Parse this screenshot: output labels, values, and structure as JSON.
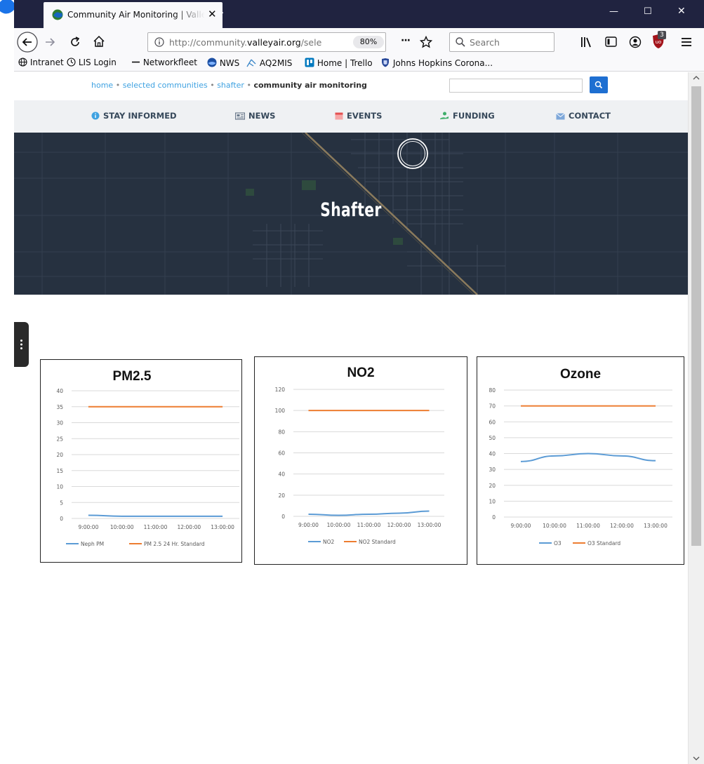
{
  "browser": {
    "tab_title": "Community Air Monitoring | Valley Air",
    "new_tab_symbol": "+",
    "close_tab_symbol": "✕",
    "url_prefix": "http://community.",
    "url_domain": "valleyair.org",
    "url_path": "/sele",
    "zoom_level": "80%",
    "page_actions": "···",
    "search_placeholder": "Search",
    "addon_badge": "3",
    "window_minimize": "—",
    "window_maximize": "☐",
    "window_close": "✕"
  },
  "bookmarks": [
    {
      "label": "Intranet",
      "icon": "globe-icon"
    },
    {
      "label": "LIS Login",
      "icon": "clock-icon"
    },
    {
      "label": "Networkfleet",
      "icon": "line-icon"
    },
    {
      "label": "NWS",
      "icon": "nws-logo-icon"
    },
    {
      "label": "AQ2MIS",
      "icon": "antenna-icon"
    },
    {
      "label": "Home | Trello",
      "icon": "trello-icon"
    },
    {
      "label": "Johns Hopkins Corona...",
      "icon": "shield-icon"
    }
  ],
  "breadcrumb": {
    "items": [
      "home",
      "selected communities",
      "shafter"
    ],
    "separator": "•",
    "current": "community air monitoring"
  },
  "nav": {
    "stay_informed": "STAY INFORMED",
    "news": "NEWS",
    "events": "EVENTS",
    "funding": "FUNDING",
    "contact": "CONTACT"
  },
  "hero": {
    "title": "Shafter"
  },
  "colors": {
    "series_blue": "#5b9bd5",
    "series_orange": "#ed7d31",
    "accent_button": "#1e6fd1",
    "hero_bg": "#263140"
  },
  "chart_data": [
    {
      "type": "line",
      "title": "PM2.5",
      "categories": [
        "9:00:00",
        "10:00:00",
        "11:00:00",
        "12:00:00",
        "13:00:00"
      ],
      "ylim": [
        0,
        40
      ],
      "yticks": [
        0,
        5,
        10,
        15,
        20,
        25,
        30,
        35,
        40
      ],
      "legend": "bottom",
      "grid": true,
      "series": [
        {
          "name": "Neph PM",
          "color": "#5b9bd5",
          "values": [
            1,
            0.7,
            0.7,
            0.7,
            0.7
          ]
        },
        {
          "name": "PM 2.5 24 Hr. Standard",
          "color": "#ed7d31",
          "values": [
            35,
            35,
            35,
            35,
            35
          ]
        }
      ]
    },
    {
      "type": "line",
      "title": "NO2",
      "categories": [
        "9:00:00",
        "10:00:00",
        "11:00:00",
        "12:00:00",
        "13:00:00"
      ],
      "ylim": [
        0,
        120
      ],
      "yticks": [
        0,
        20,
        40,
        60,
        80,
        100,
        120
      ],
      "legend": "bottom",
      "grid": true,
      "series": [
        {
          "name": "NO2",
          "color": "#5b9bd5",
          "values": [
            2,
            1,
            2,
            3,
            5
          ]
        },
        {
          "name": "NO2 Standard",
          "color": "#ed7d31",
          "values": [
            100,
            100,
            100,
            100,
            100
          ]
        }
      ]
    },
    {
      "type": "line",
      "title": "Ozone",
      "categories": [
        "9:00:00",
        "10:00:00",
        "11:00:00",
        "12:00:00",
        "13:00:00"
      ],
      "ylim": [
        0,
        80
      ],
      "yticks": [
        0,
        10,
        20,
        30,
        40,
        50,
        60,
        70,
        80
      ],
      "legend": "bottom",
      "grid": true,
      "series": [
        {
          "name": "O3",
          "color": "#5b9bd5",
          "values": [
            35,
            38.5,
            40,
            38.5,
            35.5
          ]
        },
        {
          "name": "O3 Standard",
          "color": "#ed7d31",
          "values": [
            70,
            70,
            70,
            70,
            70
          ]
        }
      ]
    }
  ]
}
